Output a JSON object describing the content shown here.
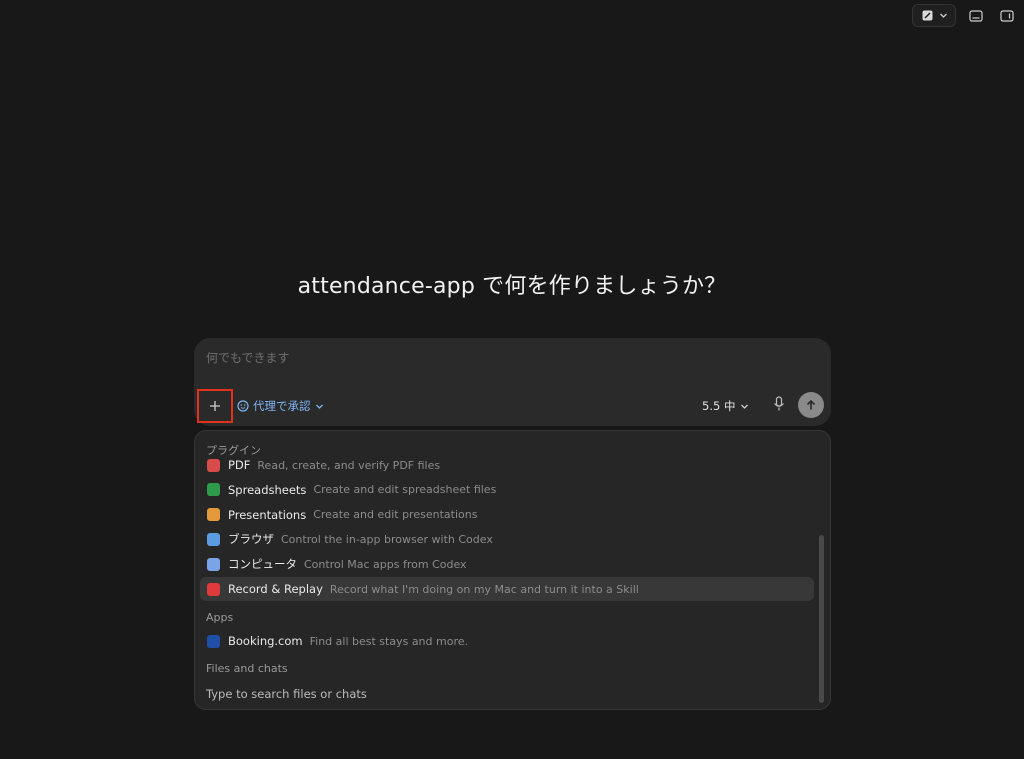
{
  "headline": "attendance-app で何を作りましょうか？",
  "composer": {
    "placeholder": "何でもできます",
    "approval_label": "代理で承認",
    "model_label": "5.5 中"
  },
  "menu": {
    "plugins_heading": "プラグイン",
    "plugins": [
      {
        "name": "PDF",
        "desc": "Read, create, and verify PDF files",
        "icon": "pdf-icon",
        "color": "#d94c4c"
      },
      {
        "name": "Spreadsheets",
        "desc": "Create and edit spreadsheet files",
        "icon": "spreadsheet-icon",
        "color": "#2e9b4a"
      },
      {
        "name": "Presentations",
        "desc": "Create and edit presentations",
        "icon": "presentation-icon",
        "color": "#e49a3a"
      },
      {
        "name": "ブラウザ",
        "desc": "Control the in-app browser with Codex",
        "icon": "browser-icon",
        "color": "#5b9be0"
      },
      {
        "name": "コンピュータ",
        "desc": "Control Mac apps from Codex",
        "icon": "computer-icon",
        "color": "#7aa4e8"
      },
      {
        "name": "Record & Replay",
        "desc": "Record what I'm doing on my Mac and turn it into a Skill",
        "icon": "record-icon",
        "color": "#e03a3a"
      }
    ],
    "apps_heading": "Apps",
    "apps": [
      {
        "name": "Booking.com",
        "desc": "Find all best stays and more.",
        "icon": "booking-icon",
        "color": "#1f4fa8"
      }
    ],
    "files_heading": "Files and chats",
    "files_hint": "Type to search files or chats"
  },
  "colors": {
    "background": "#181818",
    "accent_blue": "#7eb5f5",
    "highlight_box": "#e2311d"
  }
}
